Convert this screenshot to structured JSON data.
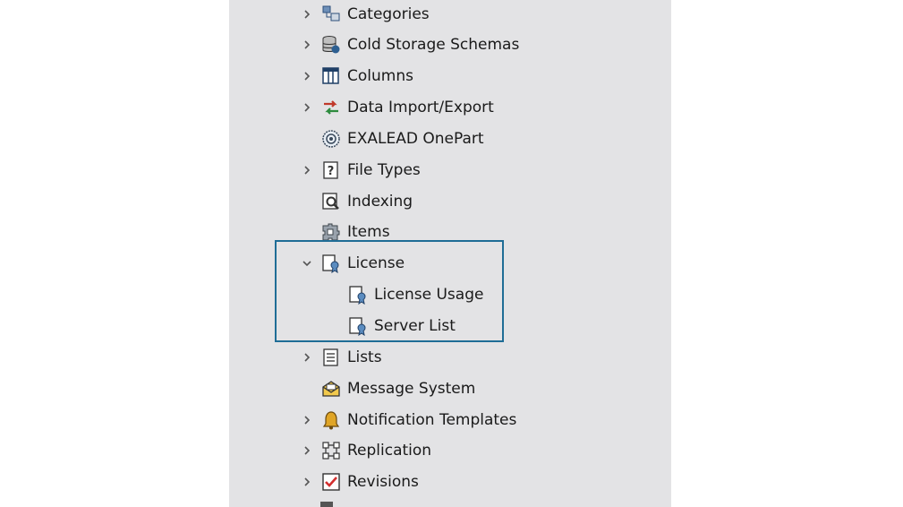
{
  "tree": {
    "items": [
      {
        "label": "Categories",
        "icon": "categories-icon",
        "expandable": true
      },
      {
        "label": "Cold Storage Schemas",
        "icon": "database-icon",
        "expandable": true
      },
      {
        "label": "Columns",
        "icon": "columns-icon",
        "expandable": true
      },
      {
        "label": "Data Import/Export",
        "icon": "import-export-icon",
        "expandable": true
      },
      {
        "label": "EXALEAD OnePart",
        "icon": "exalead-icon",
        "expandable": false
      },
      {
        "label": "File Types",
        "icon": "file-types-icon",
        "expandable": true
      },
      {
        "label": "Indexing",
        "icon": "indexing-icon",
        "expandable": false
      },
      {
        "label": "Items",
        "icon": "items-icon",
        "expandable": false
      },
      {
        "label": "License",
        "icon": "license-icon",
        "expandable": true,
        "expanded": true,
        "children": [
          {
            "label": "License Usage",
            "icon": "license-usage-icon"
          },
          {
            "label": "Server List",
            "icon": "server-list-icon"
          }
        ]
      },
      {
        "label": "Lists",
        "icon": "lists-icon",
        "expandable": true
      },
      {
        "label": "Message System",
        "icon": "message-system-icon",
        "expandable": false
      },
      {
        "label": "Notification Templates",
        "icon": "bell-icon",
        "expandable": true
      },
      {
        "label": "Replication",
        "icon": "replication-icon",
        "expandable": true
      },
      {
        "label": "Revisions",
        "icon": "revisions-icon",
        "expandable": true
      }
    ]
  },
  "colors": {
    "panel_bg": "#e3e3e5",
    "highlight_border": "#1f6d96",
    "text": "#1a1a1a"
  }
}
